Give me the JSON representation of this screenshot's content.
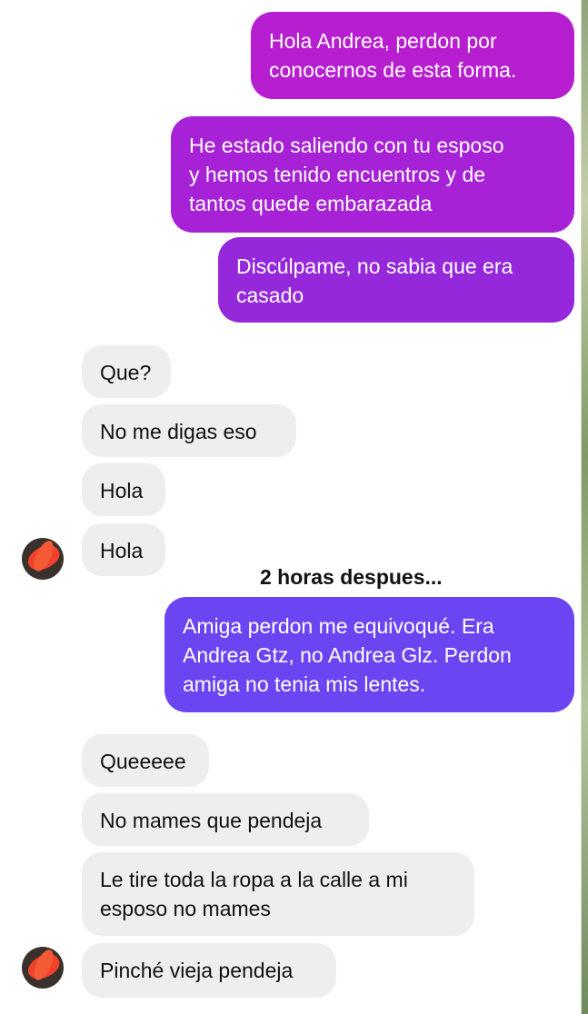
{
  "colors": {
    "sent_top": "#b51fd3",
    "sent_mid": "#8f2ee0",
    "sent_bottom": "#6c45f2",
    "received_bg": "#eeeeef"
  },
  "sent_messages": [
    "Hola Andrea, perdon por\nconocernos de esta forma.",
    "He estado saliendo con tu esposo\ny hemos tenido encuentros y de\ntantos quede embarazada",
    "Discúlpame, no sabia que era\ncasado"
  ],
  "received_group_1": [
    "Que?",
    "No me digas eso",
    "Hola",
    "Hola"
  ],
  "timestamp": "2 horas despues...",
  "sent_message_after": "Amiga perdon me equivoqué. Era\nAndrea Gtz, no Andrea Glz. Perdon\namiga no tenia mis lentes.",
  "received_group_2": [
    "Queeeee",
    "No mames que pendeja",
    "Le tire toda la ropa a la calle a mi\nesposo no mames",
    "Pinché vieja pendeja"
  ],
  "avatar_icon": "contact-avatar-icon"
}
